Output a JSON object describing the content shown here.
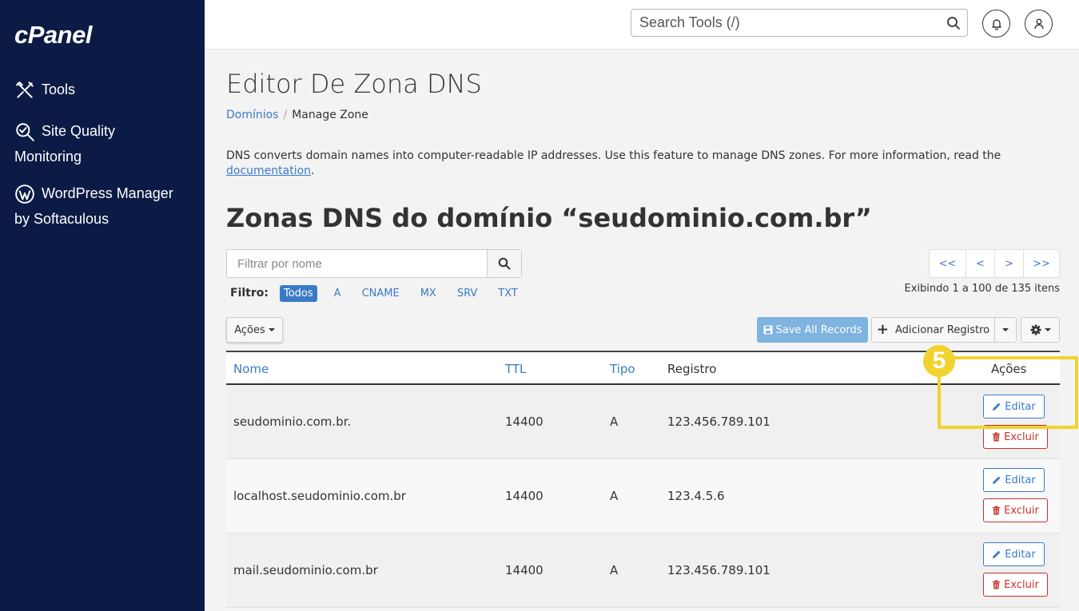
{
  "sidebar": {
    "logo": "cPanel",
    "items": [
      {
        "label": "Tools"
      },
      {
        "label_line1": "Site Quality",
        "label_line2": "Monitoring"
      },
      {
        "label_line1": "WordPress Manager",
        "label_line2": "by Softaculous"
      }
    ]
  },
  "topbar": {
    "search_placeholder": "Search Tools (/)"
  },
  "page": {
    "title": "Editor De Zona DNS",
    "breadcrumb": {
      "link": "Domínios",
      "separator": "/",
      "current": "Manage Zone"
    },
    "description_text": "DNS converts domain names into computer-readable IP addresses. Use this feature to manage DNS zones. For more information, read the ",
    "description_link": "documentation",
    "description_end": ".",
    "section_title": "Zonas DNS do domínio “seudominio.com.br”"
  },
  "filter": {
    "placeholder": "Filtrar por nome",
    "label": "Filtro:",
    "chips": [
      "Todos",
      "A",
      "CNAME",
      "MX",
      "SRV",
      "TXT"
    ],
    "active_chip": "Todos"
  },
  "pager": {
    "buttons": [
      "<<",
      "<",
      ">",
      ">>"
    ],
    "info": "Exibindo 1 a 100 de 135 itens"
  },
  "toolbar": {
    "acoes_label": "Ações",
    "save_label": "Save All Records",
    "add_label": "Adicionar Registro"
  },
  "table": {
    "headers": {
      "nome": "Nome",
      "ttl": "TTL",
      "tipo": "Tipo",
      "registro": "Registro",
      "acoes": "Ações"
    },
    "edit_label": "Editar",
    "delete_label": "Excluir",
    "rows": [
      {
        "nome": "seudominio.com.br.",
        "ttl": "14400",
        "tipo": "A",
        "registro": "123.456.789.101"
      },
      {
        "nome": "localhost.seudominio.com.br",
        "ttl": "14400",
        "tipo": "A",
        "registro": "123.4.5.6"
      },
      {
        "nome": "mail.seudominio.com.br",
        "ttl": "14400",
        "tipo": "A",
        "registro": "123.456.789.101"
      }
    ]
  },
  "annotation": {
    "step": "5"
  },
  "colors": {
    "sidebar_bg": "#0c1b45",
    "link": "#3a7bc8",
    "danger": "#c9302c",
    "highlight": "#f2d22e",
    "save_button": "#7fb3e0"
  }
}
